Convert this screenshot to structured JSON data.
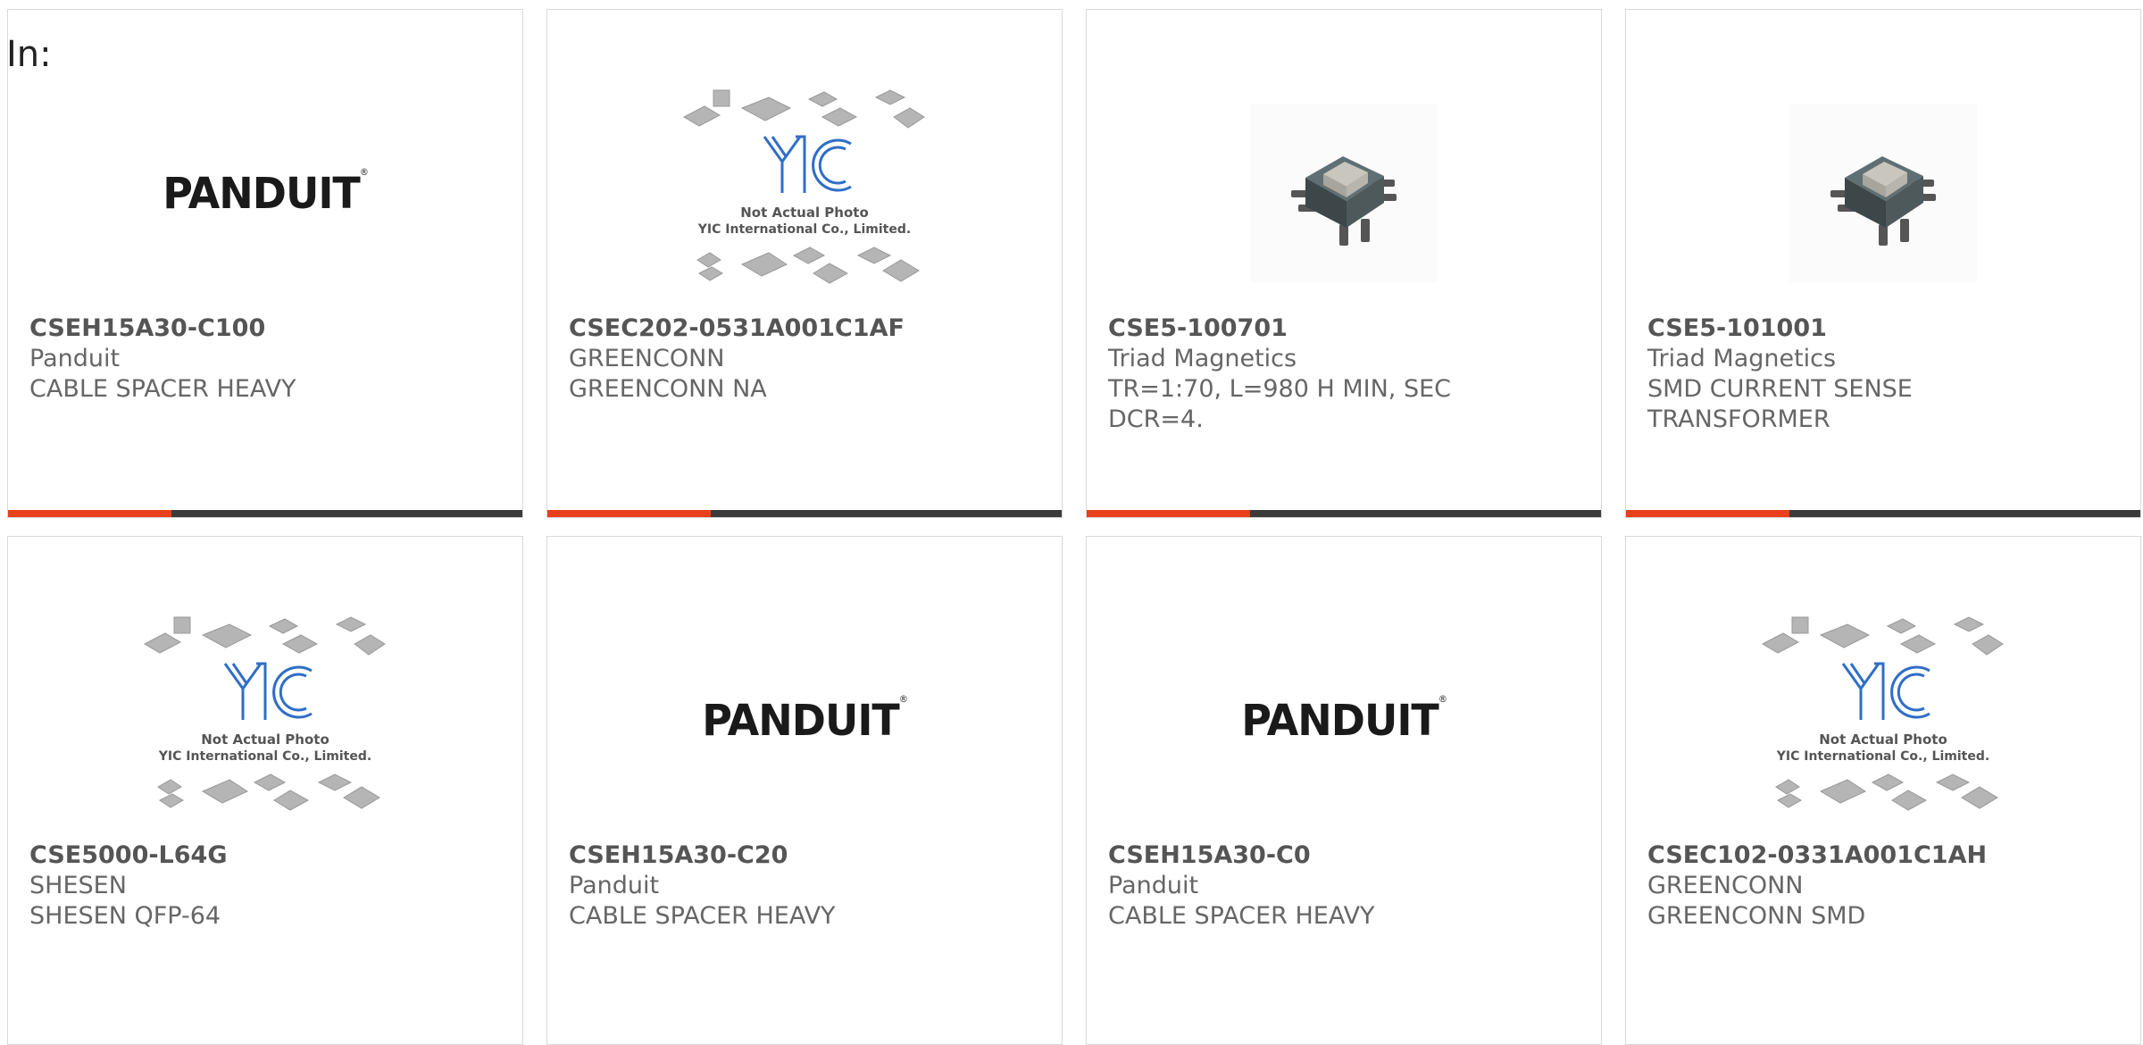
{
  "header": {
    "in_label": "In:"
  },
  "colors": {
    "accent": "#e8401c",
    "bar": "#3b3b3b",
    "text": "#666666"
  },
  "logos": {
    "panduit": "PANDUIT",
    "yic_line1": "Not Actual Photo",
    "yic_line2": "YIC International Co., Limited.",
    "yic_mark": "YIC"
  },
  "products": [
    {
      "pn": "CSEH15A30-C100",
      "mfr": "Panduit",
      "desc": "CABLE SPACER HEAVY",
      "image": "panduit-logo"
    },
    {
      "pn": "CSEC202-0531A001C1AF",
      "mfr": "GREENCONN",
      "desc": "GREENCONN NA",
      "image": "yic-placeholder"
    },
    {
      "pn": "CSE5-100701",
      "mfr": "Triad Magnetics",
      "desc": "TR=1:70, L=980 H MIN, SEC\nDCR=4.",
      "image": "transformer-photo"
    },
    {
      "pn": "CSE5-101001",
      "mfr": "Triad Magnetics",
      "desc": "SMD CURRENT SENSE\nTRANSFORMER",
      "image": "transformer-photo"
    },
    {
      "pn": "CSE5000-L64G",
      "mfr": "SHESEN",
      "desc": "SHESEN QFP-64",
      "image": "yic-placeholder"
    },
    {
      "pn": "CSEH15A30-C20",
      "mfr": "Panduit",
      "desc": "CABLE SPACER HEAVY",
      "image": "panduit-logo"
    },
    {
      "pn": "CSEH15A30-C0",
      "mfr": "Panduit",
      "desc": "CABLE SPACER HEAVY",
      "image": "panduit-logo"
    },
    {
      "pn": "CSEC102-0331A001C1AH",
      "mfr": "GREENCONN",
      "desc": "GREENCONN SMD",
      "image": "yic-placeholder"
    }
  ]
}
